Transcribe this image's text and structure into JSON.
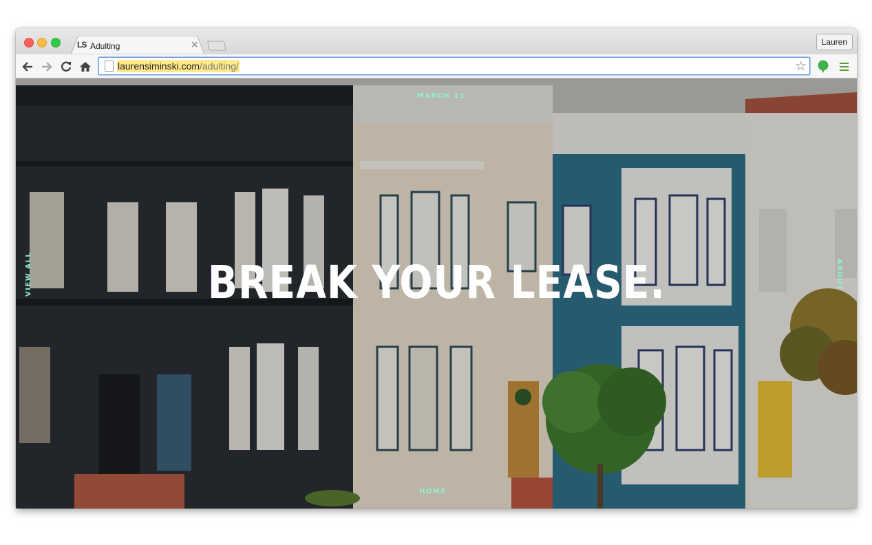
{
  "browser": {
    "tab_title": "Adulting",
    "tab_favicon_text": "LS",
    "profile_name": "Lauren",
    "url_host": "laurensiminski.com",
    "url_path": "/adulting/"
  },
  "page": {
    "date": "MARCH 11",
    "headline": "BREAK YOUR LEASE.",
    "left_link": "VIEW ALL",
    "right_link": "ABOUT",
    "bottom_link": "HOME",
    "accent_color": "#8ef0d2"
  }
}
